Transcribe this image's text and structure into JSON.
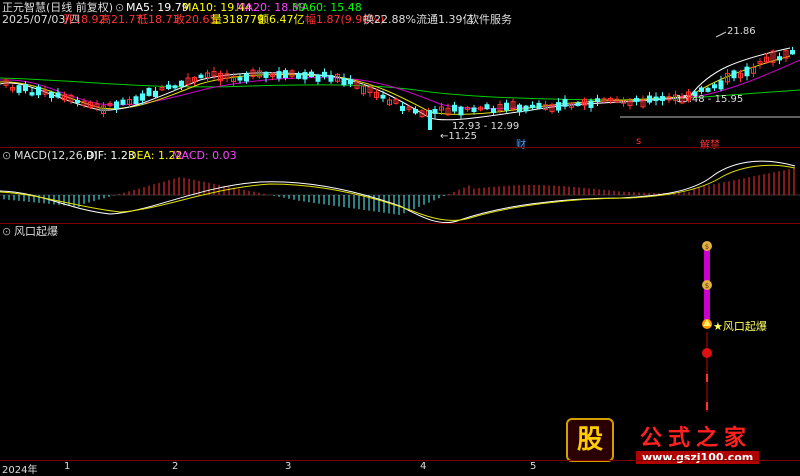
{
  "header": {
    "title": "正元智慧(日线 前复权)",
    "ma5": "MA5: 19.79",
    "ma10": "MA10: 19.44",
    "ma20": "MA20: 18.39",
    "ma60": "MA60: 15.48",
    "date": "2025/07/03/四",
    "open": "开18.92",
    "high": "高21.77",
    "low": "低18.73",
    "close": "收20.65",
    "volume": "量318779",
    "amount": "额6.47亿",
    "change": "幅1.87(9.96%)",
    "turnover": "换22.88%",
    "float": "流通1.39亿",
    "industry": "软件服务"
  },
  "price_annotations": {
    "high_label": "21.86",
    "range1": "15.48 - 15.95",
    "range2": "12.93 - 12.99",
    "low_label": "11.25",
    "marker_cai": "财",
    "marker_s": "s",
    "marker_jie": "解禁"
  },
  "macd": {
    "label": "MACD(12,26,9)",
    "dif": "DIF: 1.23",
    "dea": "DEA: 1.22",
    "macd": "MACD: 0.03"
  },
  "indicator": {
    "label": "风口起爆",
    "signal": "风口起爆"
  },
  "time_axis": {
    "year": "2024年",
    "ticks": [
      "1",
      "2",
      "3",
      "4",
      "5"
    ]
  },
  "watermark": {
    "logo_char": "股",
    "site_name": "公式之家",
    "url": "www.gszj100.com"
  },
  "colors": {
    "up": "#ff3232",
    "down": "#54ffff",
    "ma5": "#ffffff",
    "ma10": "#ffff00",
    "ma20": "#ff00ff",
    "ma60": "#00ff00",
    "bar": "#cc00cc"
  }
}
